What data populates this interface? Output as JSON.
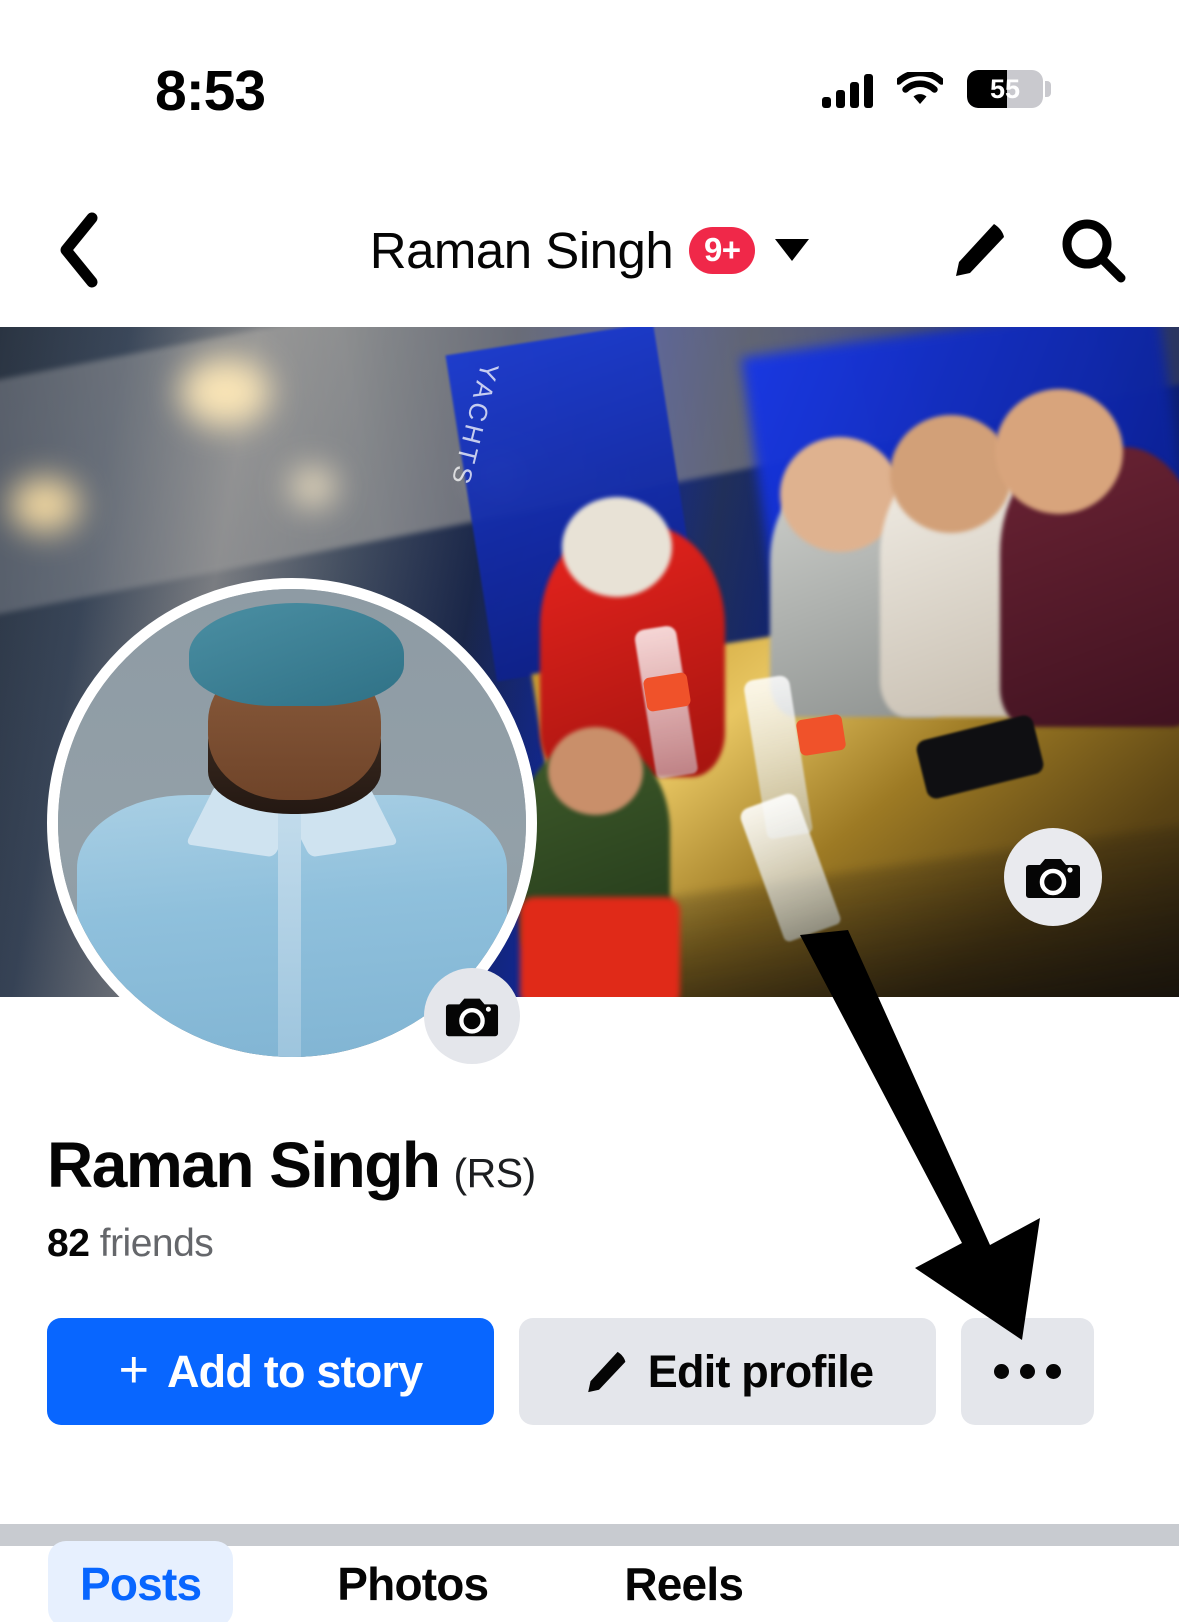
{
  "status_bar": {
    "time": "8:53",
    "battery_percent": "55",
    "icons": [
      "cellular-signal-icon",
      "wifi-icon",
      "battery-icon"
    ]
  },
  "nav_bar": {
    "back_icon": "chevron-left-icon",
    "title": "Raman Singh",
    "notification_badge": "9+",
    "caret_icon": "chevron-down-icon",
    "edit_icon": "pencil-icon",
    "search_icon": "search-icon"
  },
  "cover": {
    "banner_text": "YACHTS",
    "camera_button_icon": "camera-icon"
  },
  "profile_picture": {
    "camera_button_icon": "camera-icon"
  },
  "identity": {
    "name": "Raman Singh",
    "name_suffix": "(RS)",
    "friends_count": "82",
    "friends_label": "friends"
  },
  "actions": {
    "add_to_story": {
      "label": "Add to story",
      "plus": "+",
      "color": "#0866ff"
    },
    "edit_profile": {
      "label": "Edit profile",
      "icon": "pencil-icon",
      "color": "#e4e6eb"
    },
    "more": {
      "label": "",
      "icon": "ellipsis-icon",
      "color": "#e4e6eb"
    }
  },
  "tabs": [
    {
      "label": "Posts",
      "active": true
    },
    {
      "label": "Photos",
      "active": false
    },
    {
      "label": "Reels",
      "active": false
    }
  ],
  "annotation": {
    "type": "arrow",
    "color": "#000000",
    "points_to": "more-options-button"
  },
  "colors": {
    "accent_blue": "#0866ff",
    "badge_red": "#f02849",
    "button_gray": "#e4e6eb",
    "divider_gray": "#c8cbd0",
    "secondary_text": "#65676b"
  }
}
